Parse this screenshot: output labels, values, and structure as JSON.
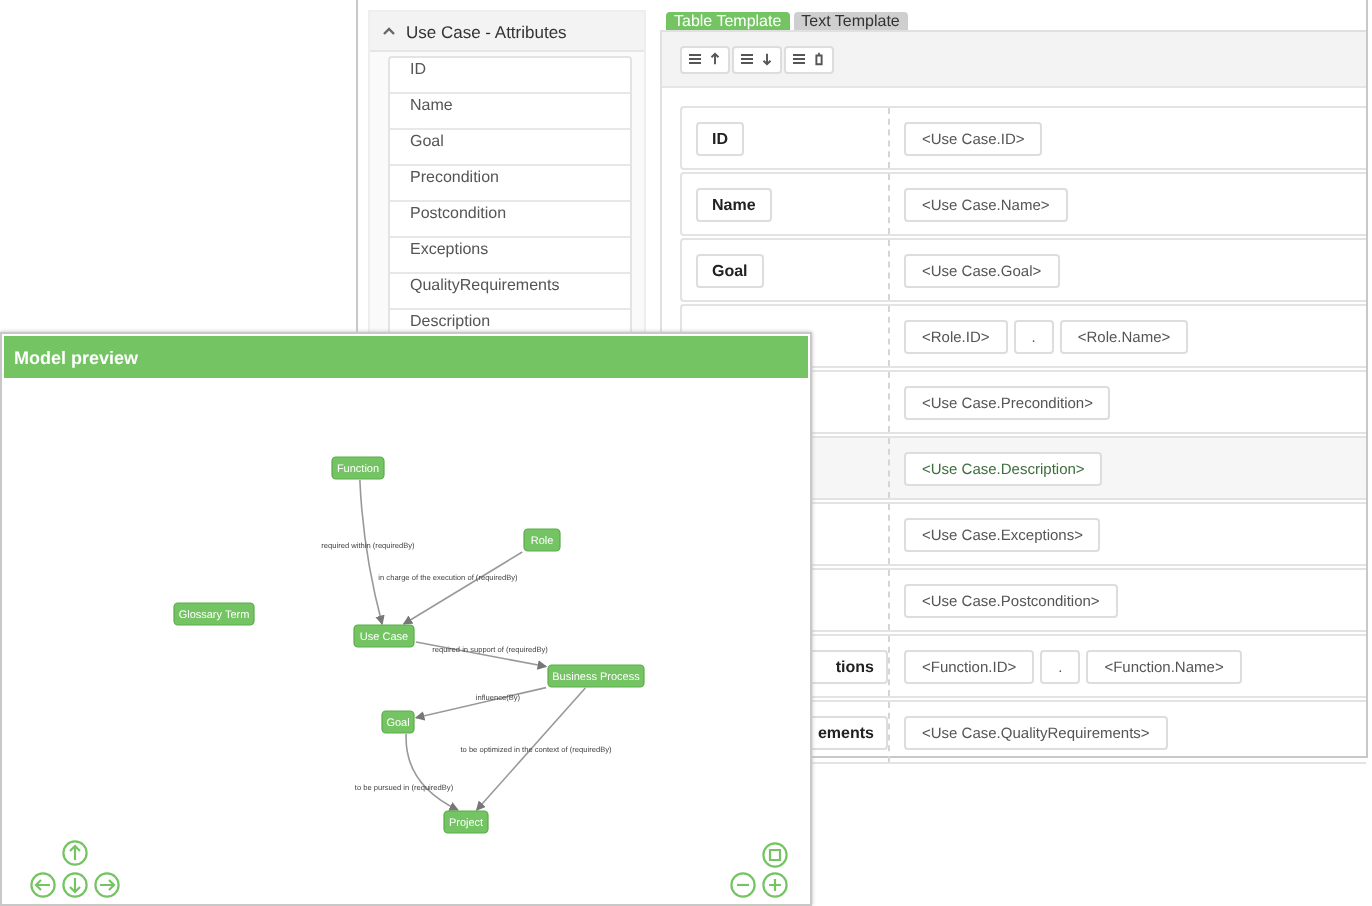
{
  "attributes_panel": {
    "title": "Use Case - Attributes",
    "expanded": true,
    "items": [
      {
        "label": "ID"
      },
      {
        "label": "Name"
      },
      {
        "label": "Goal"
      },
      {
        "label": "Precondition"
      },
      {
        "label": "Postcondition"
      },
      {
        "label": "Exceptions"
      },
      {
        "label": "QualityRequirements"
      },
      {
        "label": "Description"
      }
    ]
  },
  "tabs": [
    {
      "label": "Table Template",
      "selected": true
    },
    {
      "label": "Text Template",
      "selected": false
    }
  ],
  "template_rows": [
    {
      "label": "ID",
      "clipped": false,
      "highlighted": false,
      "fields": [
        "<Use Case.ID>"
      ]
    },
    {
      "label": "Name",
      "clipped": false,
      "highlighted": false,
      "fields": [
        "<Use Case.Name>"
      ]
    },
    {
      "label": "Goal",
      "clipped": false,
      "highlighted": false,
      "fields": [
        "<Use Case.Goal>"
      ]
    },
    {
      "highlighted": false,
      "fields": [
        "<Role.ID>",
        ".",
        "<Role.Name>"
      ]
    },
    {
      "highlighted": false,
      "fields": [
        "<Use Case.Precondition>"
      ]
    },
    {
      "highlighted": true,
      "fields": [
        "<Use Case.Description>"
      ]
    },
    {
      "highlighted": false,
      "fields": [
        "<Use Case.Exceptions>"
      ]
    },
    {
      "highlighted": false,
      "fields": [
        "<Use Case.Postcondition>"
      ]
    },
    {
      "label": "tions",
      "clipped": true,
      "highlighted": false,
      "fields": [
        "<Function.ID>",
        ".",
        "<Function.Name>"
      ]
    },
    {
      "label": "ements",
      "clipped": true,
      "highlighted": false,
      "fields": [
        "<Use Case.QualityRequirements>"
      ]
    }
  ],
  "model_preview": {
    "title": "Model preview",
    "nodes": [
      {
        "label": "Function"
      },
      {
        "label": "Role"
      },
      {
        "label": "Glossary Term"
      },
      {
        "label": "Use Case"
      },
      {
        "label": "Business Process"
      },
      {
        "label": "Goal"
      },
      {
        "label": "Project"
      }
    ],
    "edges": [
      {
        "label": "required within (requiredBy)"
      },
      {
        "label": "in charge of the execution of (requiredBy)"
      },
      {
        "label": "required in support of (requiredBy)"
      },
      {
        "label": "influence(By)"
      },
      {
        "label": "to be optimized in the context of (requiredBy)"
      },
      {
        "label": "to be pursued in (requiredBy)"
      }
    ]
  }
}
